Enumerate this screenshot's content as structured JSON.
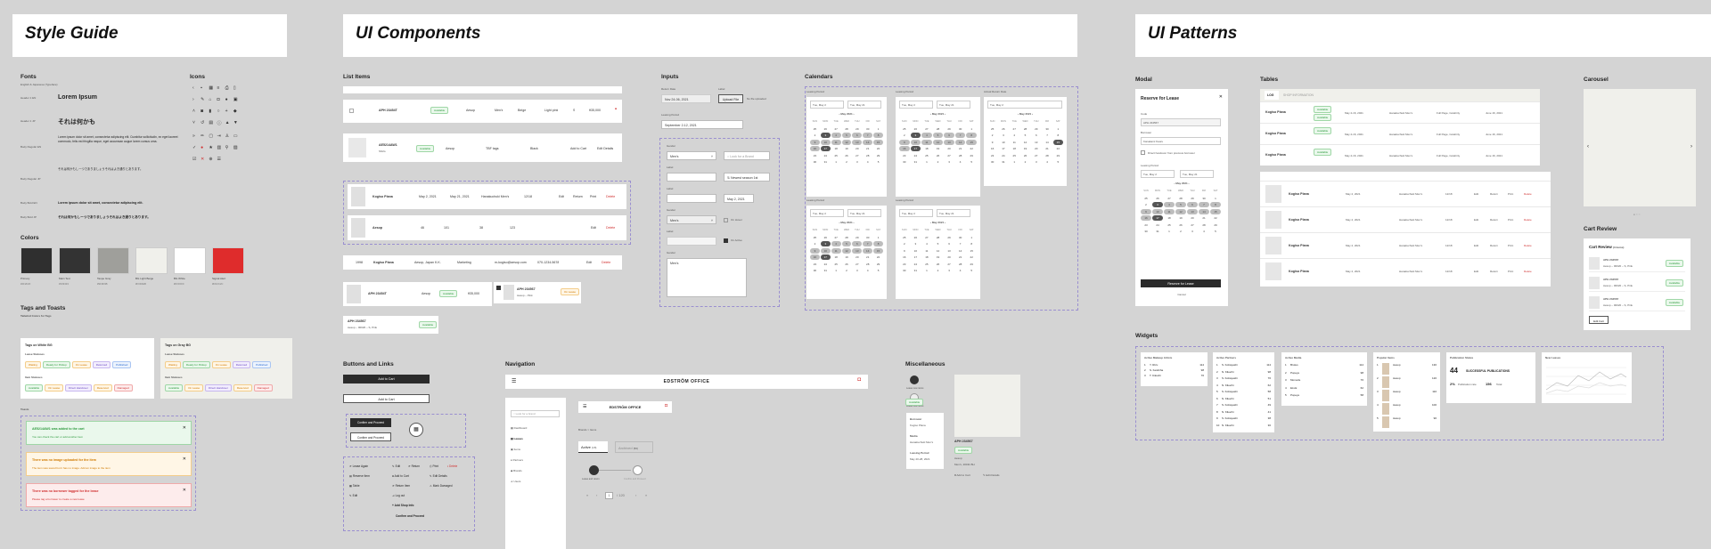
{
  "banners": {
    "style_guide": "Style Guide",
    "ui_components": "UI Components",
    "ui_patterns": "UI Patterns"
  },
  "fonts": {
    "title": "Fonts",
    "subtitle": "English & Japanese (Typeface)",
    "rows": [
      {
        "label": "Header 1 EN",
        "sample": "Lorem Ipsum"
      },
      {
        "label": "Header 1 JP",
        "sample": "それは何かも"
      },
      {
        "label": "Body Regular EN",
        "sample": "Lorem ipsum dolor sit amet, consectetur adipiscing elit. Curabitur sollicitudin, ex eget laoreet commodo, felis est fringilla neque, eget accumsan augue lorem cursus urna."
      },
      {
        "label": "Body Regular JP",
        "sample": "それは何かもしーつでありましょうそれはよき通りとあります。"
      },
      {
        "label": "Body Bold EN",
        "sample": "Lorem ipsum dolor sit amet, consectetur adipiscing elit."
      },
      {
        "label": "Body Bold JP",
        "sample": "それは何かもしーつでありましょうそれはよき通りとあります。"
      }
    ]
  },
  "icons": {
    "title": "Icons"
  },
  "colors": {
    "title": "Colors",
    "swatches": [
      {
        "name": "Primary",
        "hex": "#2F2F2F"
      },
      {
        "name": "Main Text",
        "hex": "#333333"
      },
      {
        "name": "Taupe Gray",
        "hex": "#9F9F9B"
      },
      {
        "name": "BG Light Beige",
        "hex": "#F0F0EB"
      },
      {
        "name": "BG White",
        "hex": "#FFFFFF"
      },
      {
        "name": "Signal Alert",
        "hex": "#DF2C2C"
      }
    ]
  },
  "tags": {
    "title": "Tags and Toasts",
    "subtitle": "Tailwind Colors for Tags",
    "white_bg": "Tags on White BG",
    "gray_bg": "Tags on Gray BG",
    "lease_statuses": "Lease Statuses",
    "item_statuses": "Item Statuses",
    "lease_list": [
      "Waiting",
      "Ready for Pickup",
      "On Lease",
      "Returned",
      "Published"
    ],
    "item_list": [
      "Available",
      "On Lease",
      "Direct Handover",
      "Reserved",
      "Damaged"
    ]
  },
  "toasts": {
    "title": "Toasts",
    "items": [
      {
        "title": "AE5214AW1 was added to the cart",
        "body": "You can check the cart or add another item"
      },
      {
        "title": "There was no image uploaded for the item",
        "body": "The item was saved but it has no image. Add an image to the item"
      },
      {
        "title": "There was no borrower tagged for the lease",
        "body": "Please tag a borrower to create a new lease"
      }
    ]
  },
  "list_items": {
    "title": "List Items",
    "row1": {
      "code": "APH 23454T",
      "status": "Available",
      "c1": "Aesop",
      "c2": "Men's",
      "c3": "Beige",
      "c4": "Light pink",
      "c5": "S",
      "price": "¥35,000"
    },
    "row2": {
      "code": "AE5214AW1",
      "sub": "Shirts",
      "status": "Available",
      "c1": "Aesop",
      "c2": "TBF tags",
      "c3": "Black",
      "add": "Add to Cart",
      "edit": "Edit Details"
    },
    "row3": {
      "name": "Kogiso Plana",
      "d1": "May 2, 2021",
      "d2": "May 21, 2021",
      "who": "Hanakuchuki Men's",
      "n": "12/18",
      "actions": [
        "Edit",
        "Return",
        "Print",
        "Delete"
      ]
    },
    "row4": {
      "name": "Aesop",
      "c1": "46",
      "c2": "101",
      "c3": "38",
      "c4": "123",
      "actions": [
        "Edit",
        "Delete"
      ]
    },
    "row5": {
      "id": "1998",
      "name": "Kogiso Plana",
      "c1": "Aesop, Japan K.K.",
      "c2": "Marketing",
      "c3": "m-kogiso@aesop.com",
      "c4": "070-1234-5678",
      "actions": [
        "Edit",
        "Delete"
      ]
    },
    "row6": {
      "code": "APH 23454T",
      "c1": "Aesop",
      "status": "Available",
      "price": "¥35,000"
    },
    "row7": {
      "code": "APH 234567",
      "sub": "Aesop – Pink",
      "status": "On Lease"
    },
    "row8": {
      "code": "APH 234567",
      "sub": "Aesop – 00020 – S, Pink",
      "status": "Available"
    }
  },
  "inputs": {
    "title": "Inputs",
    "return_date": "Return Date",
    "return_value": "Nov 24-06, 2021",
    "label": "Label",
    "upload": "Upload File",
    "no_file": "No file uploaded",
    "leasing_period": "Leasing Period",
    "period_value": "September 2-12, 2021",
    "gender": "Gender",
    "gender_value": "Men's",
    "search_placeholder": "Look for a Brand",
    "newest": "Newest season 1st",
    "date": "May 2, 2021",
    "on_hover": "On Hover",
    "on_active": "On Active",
    "textarea_value": "Men's"
  },
  "calendars": {
    "title": "Calendars",
    "leasing_period": "Leasing Period",
    "actual_return": "Actual Return Date",
    "month": "May 2021",
    "from": "Tue, May 2",
    "to": "Tue, May 21",
    "weekdays": [
      "SUN",
      "MON",
      "TUE",
      "WED",
      "THU",
      "FRI",
      "SAT"
    ]
  },
  "buttons": {
    "title": "Buttons and Links",
    "add_cart": "Add to Cart",
    "confirm": "Confirm and Proceed",
    "links": [
      "Lease Again",
      "Edit",
      "Return",
      "Print",
      "Delete",
      "Reserve Item",
      "Add to Cart",
      "Edit Details",
      "Table",
      "Return Item",
      "Mark Damaged",
      "Edit",
      "Log out",
      "Add Shop Info",
      "Confirm and Proceed"
    ]
  },
  "navigation": {
    "title": "Navigation",
    "brand": "EDSTRÖM OFFICE",
    "search": "Look for a brand",
    "menu": [
      "Dashboard",
      "Leases",
      "Items",
      "Partners",
      "Brands",
      "Users"
    ],
    "breadcrumb": "Brands > Items",
    "tab_active": "Active",
    "tab_active_count": "(18)",
    "tab_archived": "Archived",
    "tab_archived_count": "(56)",
    "step1": "Lease and return",
    "step2": "Confirm and Proceed",
    "page": "1",
    "pages": "/ 120"
  },
  "misc": {
    "title": "Miscellaneous",
    "lease_new": "Lease new items",
    "available": "Available",
    "borrower": "Borrower",
    "borrower_value": "Kogiso Plana",
    "media": "Media",
    "media_value": "Hanakuchuki Men's",
    "period": "Leasing Period",
    "period_value": "May 20-28, 2021",
    "item_code": "APH 234567",
    "item_brand": "Aesop",
    "item_sub": "Men's, 20011 BH",
    "add": "Add to Cart",
    "edit": "Edit Details"
  },
  "modal": {
    "title": "Modal",
    "heading": "Reserve for Lease",
    "code": "Code",
    "code_value": "APH 234567",
    "borrower": "Borrower",
    "borrower_value": "Kanakami Kaoru",
    "checkbox": "Direct handover from previous borrower",
    "period": "Leasing Period",
    "from": "Tue, May 2",
    "to": "Tue, May 21",
    "month": "May 2021",
    "submit": "Reserve for Lease",
    "cancel": "Cancel"
  },
  "tables": {
    "title": "Tables",
    "tabs": [
      "LOG",
      "SHOP INFORMATION"
    ],
    "rows": [
      {
        "name": "Kogiso Plana",
        "status1": "Available",
        "status2": "Available",
        "date": "May 2-16, 2021",
        "who": "Hanakuchuki Men's",
        "what": "Full Page, Celebrity",
        "end": "June 16, 2021"
      },
      {
        "name": "Kogiso Plana",
        "status1": "Available",
        "status2": "",
        "date": "May 2-16, 2021",
        "who": "Hanakuchuki Men's",
        "what": "Full Page, Celebrity",
        "end": "June 16, 2021"
      },
      {
        "name": "Kogiso Plana",
        "status1": "Available",
        "status2": "",
        "date": "May 2-16, 2021",
        "who": "Hanakuchuki Men's",
        "what": "Full Page, Celebrity",
        "end": "June 16, 2021"
      }
    ],
    "lease_rows": [
      {
        "name": "Kogiso Plana",
        "date": "May 2, 2021",
        "who": "Hanakuchuki Men's",
        "n": "12/18"
      },
      {
        "name": "Kogiso Plana",
        "date": "May 2, 2021",
        "who": "Hanakuchuki Men's",
        "n": "12/18"
      },
      {
        "name": "Kogiso Plana",
        "date": "May 2, 2021",
        "who": "Hanakuchuki Men's",
        "n": "12/18"
      },
      {
        "name": "Kogiso Plana",
        "date": "May 2, 2021",
        "who": "Hanakuchuki Men's",
        "n": "12/18"
      }
    ],
    "actions": [
      "Edit",
      "Return",
      "Print",
      "Delete"
    ]
  },
  "carousel": {
    "title": "Carousel"
  },
  "cart_review": {
    "title": "Cart Review",
    "heading": "Cart Review",
    "count": "(3 items)",
    "items": [
      {
        "code": "APH 234567",
        "sub": "Aesop – 00020 – S, Pink",
        "status": "Available"
      },
      {
        "code": "APH 234567",
        "sub": "Aesop – 00020 – S, Pink",
        "status": "Available"
      },
      {
        "code": "APH 234567",
        "sub": "Aesop – 00020 – S, Pink",
        "status": "Available"
      }
    ],
    "edit": "Edit Cart"
  },
  "widgets": {
    "title": "Widgets",
    "makeup": {
      "title": "Active Makeup Artists",
      "rows": [
        [
          "1",
          "Y. Rizu",
          "114"
        ],
        [
          "2",
          "S. Keishiha",
          "98"
        ],
        [
          "3",
          "T. Kikuchi",
          "76"
        ]
      ]
    },
    "partners": {
      "title": "Active Partners",
      "rows": [
        [
          "1",
          "S. Kobayashi",
          "114"
        ],
        [
          "2",
          "N. Kikuchi",
          "98"
        ],
        [
          "3",
          "S. Kobayashi",
          "76"
        ],
        [
          "4",
          "N. Kikuchi",
          "62"
        ],
        [
          "5",
          "S. Kobayashi",
          "58"
        ],
        [
          "6",
          "N. Kikuchi",
          "51"
        ],
        [
          "7",
          "S. Kobayashi",
          "49"
        ],
        [
          "8",
          "N. Kikuchi",
          "41"
        ],
        [
          "9",
          "S. Kobayashi",
          "38"
        ],
        [
          "10",
          "N. Kikuchi",
          "30"
        ]
      ]
    },
    "media": {
      "title": "Active Media",
      "rows": [
        [
          "1",
          "Brutus",
          "114"
        ],
        [
          "2",
          "Popeye",
          "98"
        ],
        [
          "3",
          "Monocle",
          "76"
        ],
        [
          "4",
          "ELLE",
          "62"
        ],
        [
          "5",
          "Popeye",
          "58"
        ]
      ]
    },
    "popular": {
      "title": "Popular Items",
      "rows": [
        [
          "1",
          "Aesop",
          "130"
        ],
        [
          "2",
          "Aesop",
          "120"
        ],
        [
          "3",
          "Aesop",
          "110"
        ],
        [
          "4",
          "Aesop",
          "100"
        ],
        [
          "5",
          "Aesop",
          "90"
        ]
      ]
    },
    "publication": {
      "title": "Publication Status",
      "count": "44",
      "label": "SUCCESSFUL PUBLICATIONS",
      "sub1": "2%",
      "sub1_label": "Publication rate",
      "sub2": "156",
      "sub2_label": "Total"
    },
    "leases": {
      "title": "New Leases"
    }
  }
}
